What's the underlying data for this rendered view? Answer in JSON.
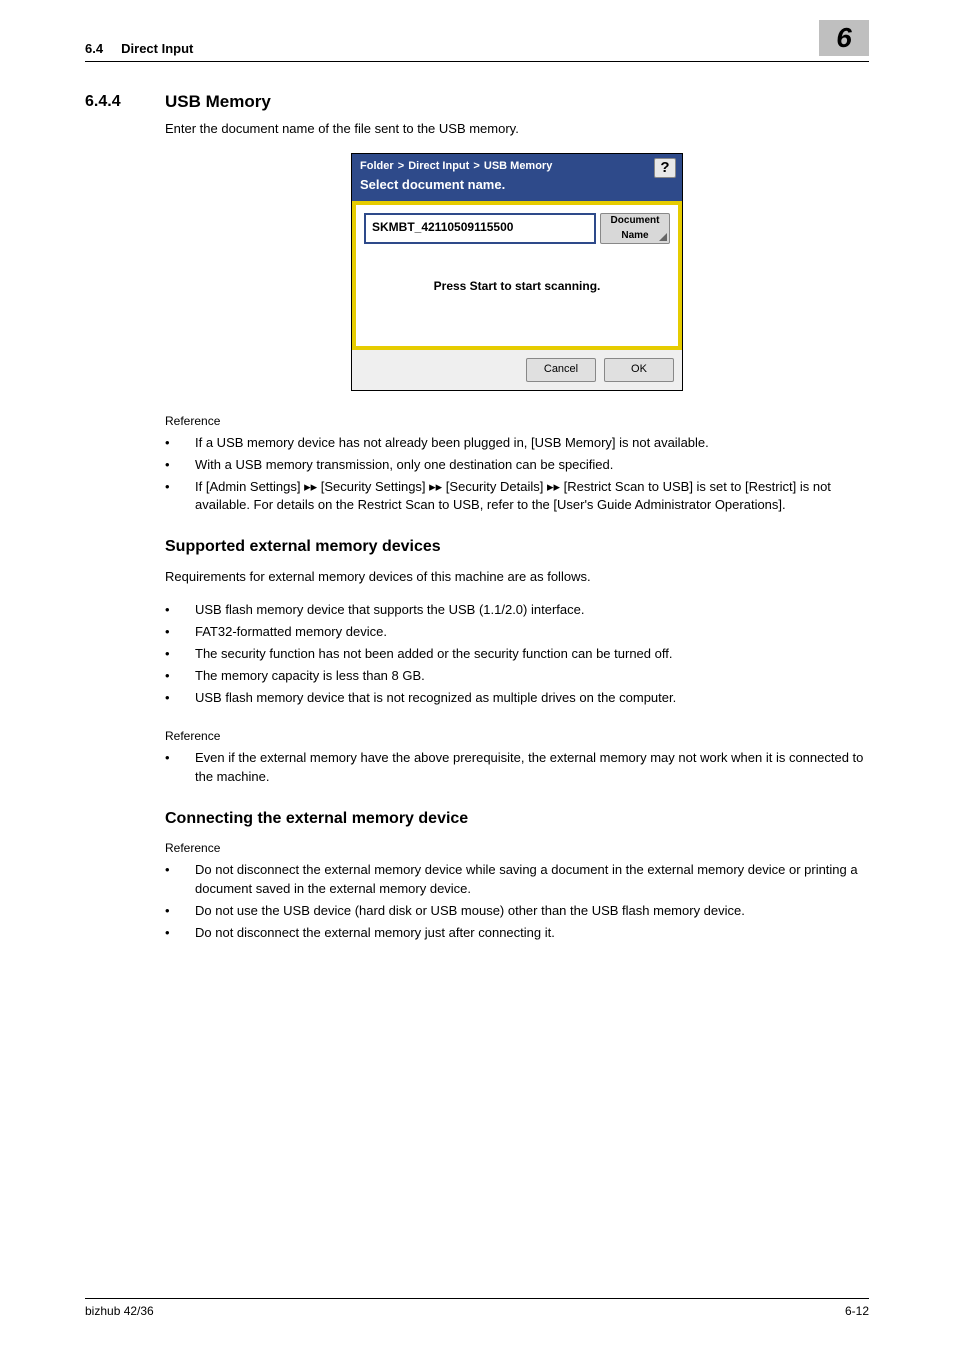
{
  "header": {
    "section_num_short": "6.4",
    "section_title_short": "Direct Input",
    "chapter_number": "6"
  },
  "section": {
    "number": "6.4.4",
    "title": "USB Memory",
    "lead": "Enter the document name of the file sent to the USB memory."
  },
  "screenshot": {
    "breadcrumb": {
      "a": "Folder",
      "b": "Direct Input",
      "c": "USB Memory"
    },
    "subtitle": "Select document name.",
    "help_label": "?",
    "doc_value": "SKMBT_42110509115500",
    "doc_btn_line1": "Document",
    "doc_btn_line2": "Name",
    "press_msg": "Press Start to start scanning.",
    "cancel": "Cancel",
    "ok": "OK"
  },
  "ref1": {
    "label": "Reference",
    "items": [
      "If a USB memory device has not already been plugged in, [USB Memory] is not available.",
      "With a USB memory transmission, only one destination can be specified.",
      "If [Admin Settings] ▸▸ [Security Settings] ▸▸ [Security Details] ▸▸ [Restrict Scan to USB] is set to [Restrict] is not available. For details on the Restrict Scan to USB, refer to the [User's Guide Administrator Operations]."
    ]
  },
  "supported": {
    "heading": "Supported external memory devices",
    "lead": "Requirements for external memory devices of this machine are as follows.",
    "items": [
      "USB flash memory device that supports the USB (1.1/2.0) interface.",
      "FAT32-formatted memory device.",
      "The security function has not been added or the security function can be turned off.",
      "The memory capacity is less than 8 GB.",
      "USB flash memory device that is not recognized as multiple drives on the computer."
    ],
    "ref_label": "Reference",
    "ref_items": [
      "Even if the external memory have the above prerequisite, the external memory may not work when it is connected to the machine."
    ]
  },
  "connecting": {
    "heading": "Connecting the external memory device",
    "ref_label": "Reference",
    "items": [
      "Do not disconnect the external memory device while saving a document in the external memory device or printing a document saved in the external memory device.",
      "Do not use the USB device (hard disk or USB mouse) other than the USB flash memory device.",
      "Do not disconnect the external memory just after connecting it."
    ]
  },
  "footer": {
    "left": "bizhub 42/36",
    "right": "6-12"
  }
}
